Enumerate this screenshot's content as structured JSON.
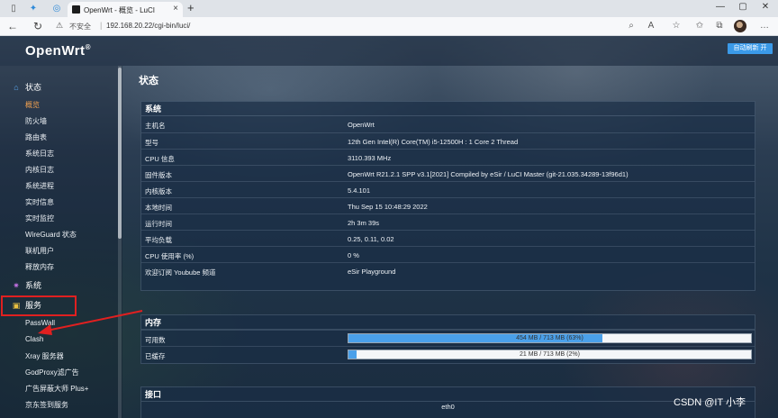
{
  "browser": {
    "tab_title": "OpenWrt - 概览 - LuCI",
    "insecure_label": "不安全",
    "url": "192.168.20.22/cgi-bin/luci/"
  },
  "header": {
    "brand": "OpenWrt",
    "brand_mark": "®",
    "refresh_label": "自动刷新 开"
  },
  "sidebar": {
    "groups": [
      {
        "label": "状态",
        "icon": "home-icon"
      },
      {
        "label": "系统",
        "icon": "gear-icon"
      },
      {
        "label": "服务",
        "icon": "services-icon"
      }
    ],
    "status_items": [
      "概览",
      "防火墙",
      "路由表",
      "系统日志",
      "内核日志",
      "系统进程",
      "实时信息",
      "实时监控",
      "WireGuard 状态",
      "联机用户",
      "释放内存"
    ],
    "service_items": [
      "PassWall",
      "Clash",
      "Xray 服务器",
      "GodProxy滤广告",
      "广告屏蔽大师 Plus+",
      "京东签到服务"
    ]
  },
  "main": {
    "title": "状态",
    "system": {
      "heading": "系统",
      "rows": [
        {
          "k": "主机名",
          "v": "OpenWrt"
        },
        {
          "k": "型号",
          "v": "12th Gen Intel(R) Core(TM) i5-12500H : 1 Core 2 Thread"
        },
        {
          "k": "CPU 信息",
          "v": "3110.393 MHz"
        },
        {
          "k": "固件版本",
          "v": "OpenWrt R21.2.1 SPP v3.1[2021] Compiled by eSir / LuCI Master (git-21.035.34289-13f96d1)"
        },
        {
          "k": "内核版本",
          "v": "5.4.101"
        },
        {
          "k": "本地时间",
          "v": "Thu Sep 15 10:48:29 2022"
        },
        {
          "k": "运行时间",
          "v": "2h 3m 39s"
        },
        {
          "k": "平均负载",
          "v": "0.25, 0.11, 0.02"
        },
        {
          "k": "CPU 使用率 (%)",
          "v": "0 %"
        },
        {
          "k": "欢迎订阅 Youbube 频道",
          "v": "eSir Playground"
        }
      ]
    },
    "memory": {
      "heading": "内存",
      "rows": [
        {
          "k": "可用数",
          "label": "454 MB / 713 MB (63%)",
          "percent": 63
        },
        {
          "k": "已缓存",
          "label": "21 MB / 713 MB (2%)",
          "percent": 2
        }
      ]
    },
    "interfaces": {
      "heading": "接口",
      "first_interface": "eth0"
    }
  },
  "watermark": "CSDN @IT 小李",
  "colors": {
    "accent": "#3b9ae8",
    "active_menu": "#f0a050",
    "highlight": "#e02020"
  }
}
